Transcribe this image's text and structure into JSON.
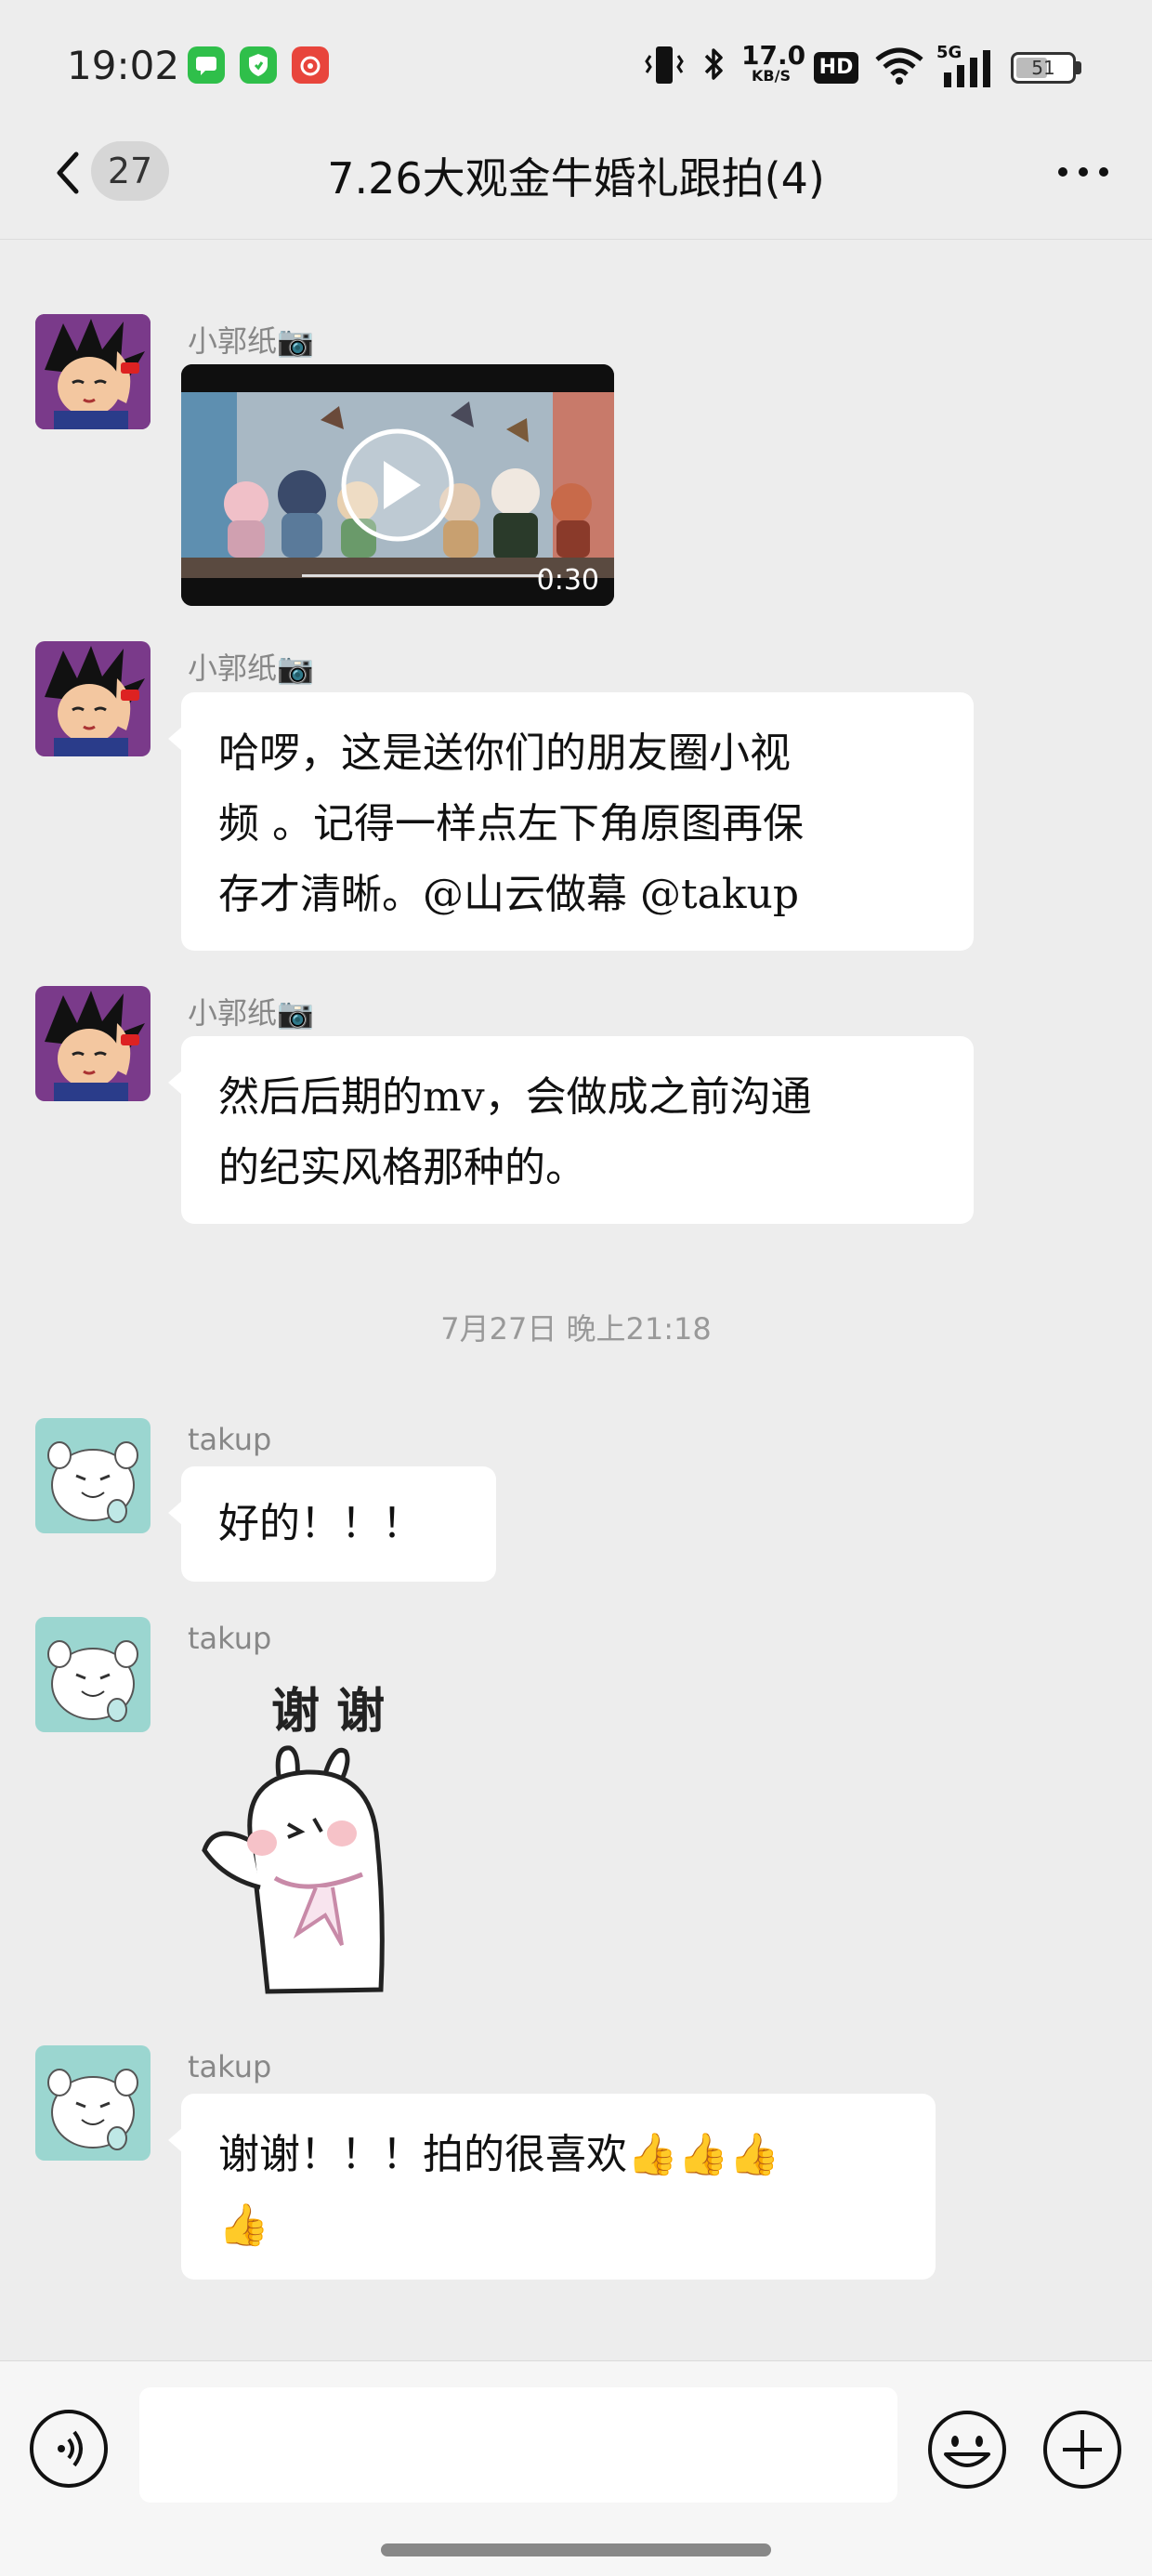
{
  "status_bar": {
    "time": "19:02",
    "network_speed": "17.0",
    "network_speed_unit": "KB/S",
    "hd_label": "HD",
    "network_type": "5G",
    "battery": "51"
  },
  "header": {
    "unread_count": "27",
    "title": "7.26大观金牛婚礼跟拍(4)"
  },
  "messages": [
    {
      "sender": "小郭纸📷",
      "video_duration": "0:30"
    },
    {
      "sender": "小郭纸📷",
      "lines": [
        "哈啰，这是送你们的朋友圈小视",
        "频 。记得一样点左下角原图再保",
        "存才清晰。@山云做幕 @takup"
      ]
    },
    {
      "sender": "小郭纸📷",
      "lines": [
        "然后后期的mv，会做成之前沟通",
        "的纪实风格那种的。"
      ]
    },
    {
      "sender": "takup",
      "lines": [
        "好的！！！"
      ]
    },
    {
      "sender": "takup",
      "sticker_text": "谢 谢"
    },
    {
      "sender": "takup",
      "lines": [
        "谢谢！！！拍的很喜欢👍👍👍",
        "👍"
      ]
    }
  ],
  "timestamp": "7月27日 晚上21:18",
  "colors": {
    "background": "#ededed",
    "bubble": "#ffffff",
    "status_green": "#2fbf4a",
    "status_red": "#e8453c"
  }
}
